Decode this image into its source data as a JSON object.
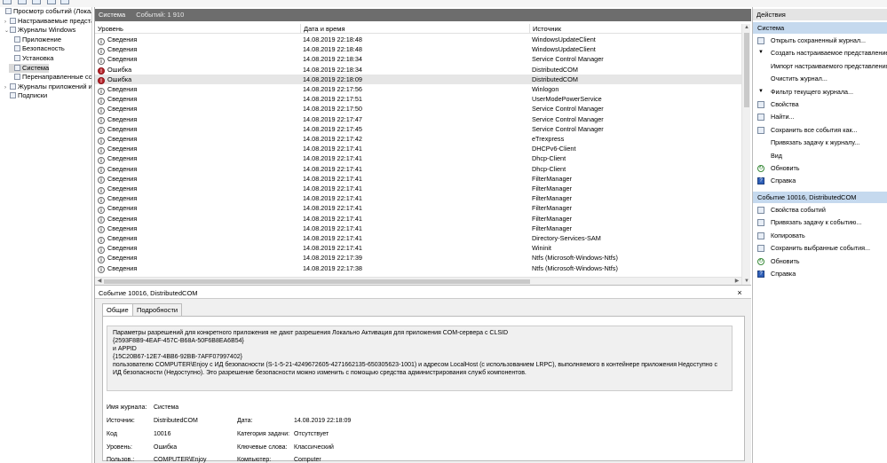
{
  "tree": {
    "items": [
      {
        "label": "Просмотр событий (Локальный)",
        "indent": 0,
        "twist": ""
      },
      {
        "label": "Настраиваемые представления",
        "indent": 1,
        "twist": "›"
      },
      {
        "label": "Журналы Windows",
        "indent": 1,
        "twist": "⌄"
      },
      {
        "label": "Приложение",
        "indent": 2,
        "twist": ""
      },
      {
        "label": "Безопасность",
        "indent": 2,
        "twist": ""
      },
      {
        "label": "Установка",
        "indent": 2,
        "twist": ""
      },
      {
        "label": "Система",
        "indent": 2,
        "twist": ""
      },
      {
        "label": "Перенаправленные события",
        "indent": 2,
        "twist": ""
      },
      {
        "label": "Журналы приложений и служб",
        "indent": 1,
        "twist": "›"
      },
      {
        "label": "Подписки",
        "indent": 1,
        "twist": ""
      }
    ],
    "selected_index": 6
  },
  "center": {
    "title": "Система",
    "count": "Событий: 1 910",
    "columns": [
      "Уровень",
      "Дата и время",
      "Источник"
    ],
    "rows": [
      {
        "level": "Сведения",
        "type": "info",
        "date": "14.08.2019 22:18:48",
        "source": "WindowsUpdateClient"
      },
      {
        "level": "Сведения",
        "type": "info",
        "date": "14.08.2019 22:18:48",
        "source": "WindowsUpdateClient"
      },
      {
        "level": "Сведения",
        "type": "info",
        "date": "14.08.2019 22:18:34",
        "source": "Service Control Manager"
      },
      {
        "level": "Ошибка",
        "type": "err",
        "date": "14.08.2019 22:18:34",
        "source": "DistributedCOM"
      },
      {
        "level": "Ошибка",
        "type": "err",
        "date": "14.08.2019 22:18:09",
        "source": "DistributedCOM"
      },
      {
        "level": "Сведения",
        "type": "info",
        "date": "14.08.2019 22:17:56",
        "source": "Winlogon"
      },
      {
        "level": "Сведения",
        "type": "info",
        "date": "14.08.2019 22:17:51",
        "source": "UserModePowerService"
      },
      {
        "level": "Сведения",
        "type": "info",
        "date": "14.08.2019 22:17:50",
        "source": "Service Control Manager"
      },
      {
        "level": "Сведения",
        "type": "info",
        "date": "14.08.2019 22:17:47",
        "source": "Service Control Manager"
      },
      {
        "level": "Сведения",
        "type": "info",
        "date": "14.08.2019 22:17:45",
        "source": "Service Control Manager"
      },
      {
        "level": "Сведения",
        "type": "info",
        "date": "14.08.2019 22:17:42",
        "source": "eTrexpress"
      },
      {
        "level": "Сведения",
        "type": "info",
        "date": "14.08.2019 22:17:41",
        "source": "DHCPv6-Client"
      },
      {
        "level": "Сведения",
        "type": "info",
        "date": "14.08.2019 22:17:41",
        "source": "Dhcp-Client"
      },
      {
        "level": "Сведения",
        "type": "info",
        "date": "14.08.2019 22:17:41",
        "source": "Dhcp-Client"
      },
      {
        "level": "Сведения",
        "type": "info",
        "date": "14.08.2019 22:17:41",
        "source": "FilterManager"
      },
      {
        "level": "Сведения",
        "type": "info",
        "date": "14.08.2019 22:17:41",
        "source": "FilterManager"
      },
      {
        "level": "Сведения",
        "type": "info",
        "date": "14.08.2019 22:17:41",
        "source": "FilterManager"
      },
      {
        "level": "Сведения",
        "type": "info",
        "date": "14.08.2019 22:17:41",
        "source": "FilterManager"
      },
      {
        "level": "Сведения",
        "type": "info",
        "date": "14.08.2019 22:17:41",
        "source": "FilterManager"
      },
      {
        "level": "Сведения",
        "type": "info",
        "date": "14.08.2019 22:17:41",
        "source": "FilterManager"
      },
      {
        "level": "Сведения",
        "type": "info",
        "date": "14.08.2019 22:17:41",
        "source": "Directory-Services-SAM"
      },
      {
        "level": "Сведения",
        "type": "info",
        "date": "14.08.2019 22:17:41",
        "source": "Wininit"
      },
      {
        "level": "Сведения",
        "type": "info",
        "date": "14.08.2019 22:17:39",
        "source": "Ntfs (Microsoft-Windows-Ntfs)"
      },
      {
        "level": "Сведения",
        "type": "info",
        "date": "14.08.2019 22:17:38",
        "source": "Ntfs (Microsoft-Windows-Ntfs)"
      }
    ],
    "selected_row": 4
  },
  "detail": {
    "title": "Событие 10016, DistributedCOM",
    "close": "×",
    "tabs": [
      "Общие",
      "Подробности"
    ],
    "message": [
      "Параметры разрешений для конкретного приложения не дают разрешения Локально Активация для приложения COM-сервера с CLSID",
      "{2593F8B9-4EAF-457C-B68A-50F6B8EA6B54}",
      " и APPID",
      "{15C20B67-12E7-4BB6-92BB-7AFF07997402}",
      " пользователю COMPUTER\\Enjoy с ИД безопасности (S-1-5-21-4249672605-4271662135-650305623-1001) и адресом LocalHost (с использованием LRPC), выполняемого в контейнере приложения Недоступно с ИД безопасности (Недоступно). Это разрешение безопасности можно изменить с помощью средства администрирования служб компонентов."
    ],
    "props": {
      "log_label": "Имя журнала:",
      "log_value": "Система",
      "source_label": "Источник:",
      "source_value": "DistributedCOM",
      "date_label": "Дата:",
      "date_value": "14.08.2019 22:18:09",
      "code_label": "Код",
      "code_value": "10016",
      "task_label": "Категория задачи:",
      "task_value": "Отсутствует",
      "level_label": "Уровень:",
      "level_value": "Ошибка",
      "keywords_label": "Ключевые слова:",
      "keywords_value": "Классический",
      "user_label": "Пользов.:",
      "user_value": "COMPUTER\\Enjoy",
      "computer_label": "Компьютер:",
      "computer_value": "Computer"
    }
  },
  "actions": {
    "header": "Действия",
    "section1": "Система",
    "items1": [
      {
        "label": "Открыть сохраненный журнал...",
        "icon": "open-log-icon",
        "glyph": "",
        "cls": ""
      },
      {
        "label": "Создать настраиваемое представление...",
        "icon": "filter-icon",
        "glyph": "▼",
        "cls": "none"
      },
      {
        "label": "Импорт настраиваемого представления...",
        "icon": "import-icon",
        "glyph": "",
        "cls": "none"
      },
      {
        "label": "Очистить журнал...",
        "icon": "clear-icon",
        "glyph": "",
        "cls": "none"
      },
      {
        "label": "Фильтр текущего журнала...",
        "icon": "filter-icon",
        "glyph": "▼",
        "cls": "none"
      },
      {
        "label": "Свойства",
        "icon": "properties-icon",
        "glyph": "",
        "cls": ""
      },
      {
        "label": "Найти...",
        "icon": "find-icon",
        "glyph": "",
        "cls": ""
      },
      {
        "label": "Сохранить все события как...",
        "icon": "save-icon",
        "glyph": "",
        "cls": ""
      },
      {
        "label": "Привязать задачу к журналу...",
        "icon": "task-icon",
        "glyph": "",
        "cls": "none"
      },
      {
        "label": "Вид",
        "icon": "view-icon",
        "glyph": "",
        "cls": "none"
      },
      {
        "label": "Обновить",
        "icon": "refresh-icon",
        "glyph": "↻",
        "cls": "green"
      },
      {
        "label": "Справка",
        "icon": "help-icon",
        "glyph": "?",
        "cls": "blue"
      }
    ],
    "section2": "Событие 10016, DistributedCOM",
    "items2": [
      {
        "label": "Свойства событий",
        "icon": "event-properties-icon",
        "glyph": "",
        "cls": ""
      },
      {
        "label": "Привязать задачу к событию...",
        "icon": "task-icon",
        "glyph": "",
        "cls": ""
      },
      {
        "label": "Копировать",
        "icon": "copy-icon",
        "glyph": "",
        "cls": ""
      },
      {
        "label": "Сохранить выбранные события...",
        "icon": "save-icon",
        "glyph": "",
        "cls": ""
      },
      {
        "label": "Обновить",
        "icon": "refresh-icon",
        "glyph": "↻",
        "cls": "green"
      },
      {
        "label": "Справка",
        "icon": "help-icon",
        "glyph": "?",
        "cls": "blue"
      }
    ]
  }
}
